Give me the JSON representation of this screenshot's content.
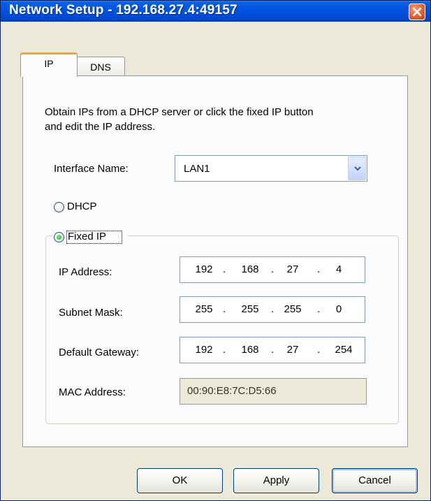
{
  "window": {
    "title": "Network Setup - 192.168.27.4:49157"
  },
  "tabs": [
    {
      "label": "IP",
      "active": true
    },
    {
      "label": "DNS",
      "active": false
    }
  ],
  "description": {
    "line1": "Obtain IPs from a DHCP server or click the fixed IP button",
    "line2": "and edit the IP address."
  },
  "interface": {
    "label": "Interface Name:",
    "value": "LAN1"
  },
  "mode": {
    "dhcp_label": "DHCP",
    "fixed_label": "Fixed IP",
    "selected": "Fixed IP"
  },
  "fields": {
    "ip": {
      "label": "IP Address:",
      "octets": [
        "192",
        "168",
        "27",
        "4"
      ]
    },
    "subnet": {
      "label": "Subnet Mask:",
      "octets": [
        "255",
        "255",
        "255",
        "0"
      ]
    },
    "gateway": {
      "label": "Default Gateway:",
      "octets": [
        "192",
        "168",
        "27",
        "254"
      ]
    },
    "mac": {
      "label": "MAC Address:",
      "value": "00:90:E8:7C:D5:66"
    }
  },
  "buttons": {
    "ok": "OK",
    "apply": "Apply",
    "cancel": "Cancel"
  },
  "colors": {
    "titlebar": "#0054e3",
    "dialog_bg": "#ece9d8",
    "tab_highlight": "#f3a52c",
    "radio_selected": "#21a121"
  },
  "icons": {
    "close": "close-icon",
    "dropdown": "chevron-down-icon"
  }
}
